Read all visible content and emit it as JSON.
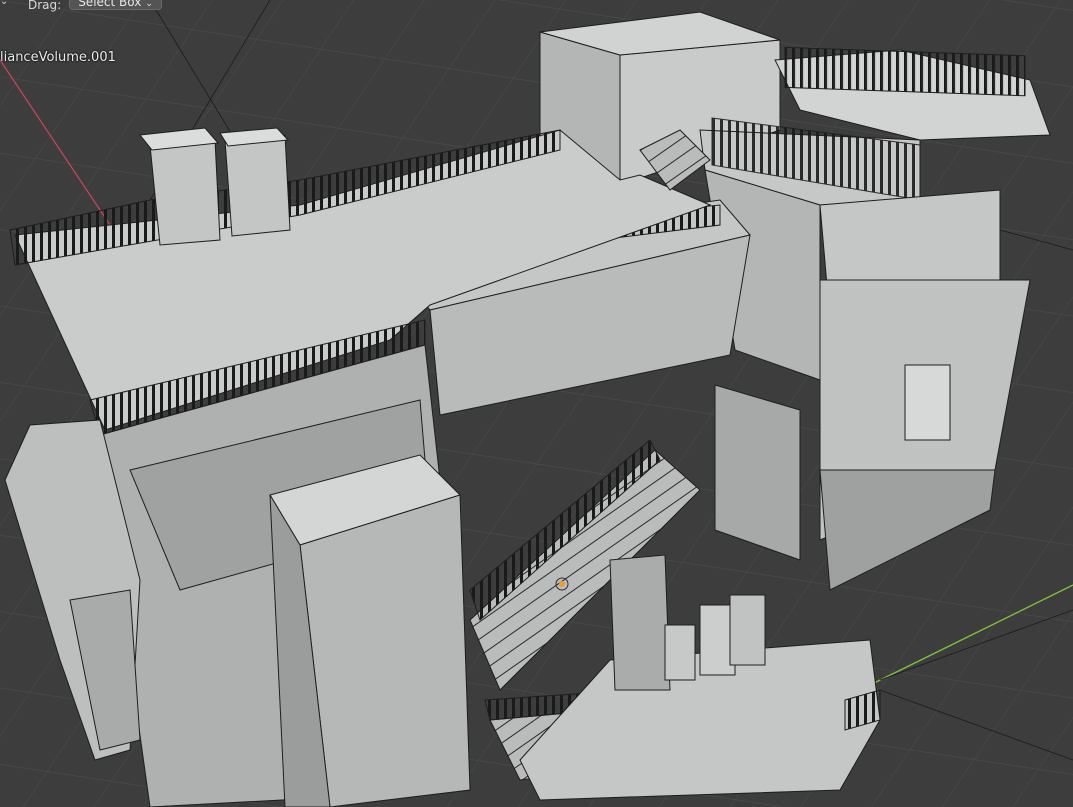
{
  "header": {
    "drag_label": "Drag:",
    "select_mode": "Select Box",
    "chevron": "⌄"
  },
  "viewport": {
    "object_name": "lianceVolume.001",
    "shading": "solid wireframe overlay",
    "colors": {
      "background": "#3d3d3d",
      "grid": "#4a4a4a",
      "mesh_light": "#c9cccb",
      "mesh_mid": "#a9acab",
      "mesh_dark": "#8a8d8c",
      "wire": "#1e1e1e",
      "x_axis": "#c44a55",
      "y_axis": "#7fbf3a",
      "origin": "#f29a2e"
    }
  }
}
